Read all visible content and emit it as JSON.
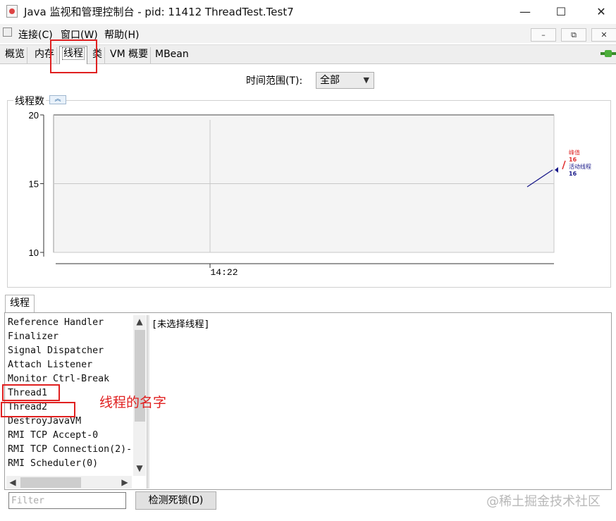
{
  "window": {
    "title": "Java 监视和管理控制台 - pid: 11412 ThreadTest.Test7",
    "minimize": "—",
    "maximize": "☐",
    "close": "✕"
  },
  "menu": {
    "items": [
      "连接(C)",
      "窗口(W)",
      "帮助(H)"
    ],
    "mdi_buttons": [
      "–",
      "⧉",
      "✕"
    ]
  },
  "tabs": [
    "概览",
    "内存",
    "线程",
    "类",
    "VM 概要",
    "MBean"
  ],
  "active_tab": "线程",
  "time_range": {
    "label": "时间范围(T):",
    "selected": "全部"
  },
  "chart_panel": {
    "title": "线程数",
    "collapse_icon": "double-chevron-up-icon"
  },
  "chart_data": {
    "type": "line",
    "title": "线程数",
    "y_ticks": [
      "20",
      "15",
      "10"
    ],
    "ylim": [
      10,
      20
    ],
    "x_ticks": [
      "14:22"
    ],
    "grid": true,
    "series": [
      {
        "name": "峰值",
        "color": "#e03030",
        "x": [
          "14:22"
        ],
        "values": [
          16
        ]
      },
      {
        "name": "活动线程",
        "color": "#1a1a8a",
        "x": [
          "14:22"
        ],
        "values": [
          16
        ]
      }
    ],
    "legend": [
      {
        "label": "峰值",
        "value": "16",
        "color": "#e03030"
      },
      {
        "label": "活动线程",
        "value": "16",
        "color": "#1a1a8a"
      }
    ],
    "legend_position": "right"
  },
  "threads_tab": "线程",
  "threads": [
    "Reference Handler",
    "Finalizer",
    "Signal Dispatcher",
    "Attach Listener",
    "Monitor Ctrl-Break",
    "Thread1",
    "Thread2",
    "DestroyJavaVM",
    "RMI TCP Accept-0",
    "RMI TCP Connection(2)-",
    "RMI Scheduler(0)"
  ],
  "detail_text": "[未选择线程]",
  "filter_placeholder": "Filter",
  "deadlock_button": "检测死锁(D)",
  "annotation": "线程的名字",
  "watermark": "@稀土掘金技术社区",
  "colors": {
    "highlight": "#e02020",
    "peak": "#e03030",
    "live": "#1a1a8a"
  }
}
